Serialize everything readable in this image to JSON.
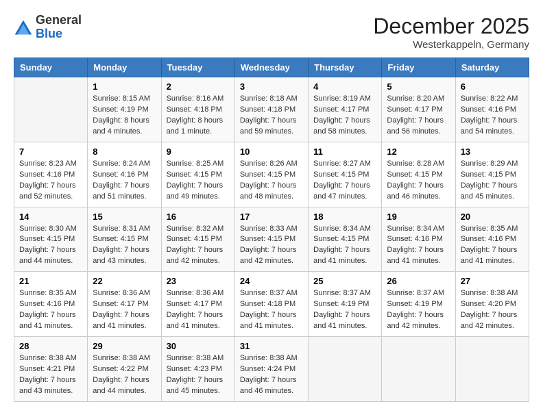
{
  "header": {
    "logo_general": "General",
    "logo_blue": "Blue",
    "month_title": "December 2025",
    "location": "Westerkappeln, Germany"
  },
  "days_of_week": [
    "Sunday",
    "Monday",
    "Tuesday",
    "Wednesday",
    "Thursday",
    "Friday",
    "Saturday"
  ],
  "weeks": [
    [
      {
        "day": "",
        "sunrise": "",
        "sunset": "",
        "daylight": ""
      },
      {
        "day": "1",
        "sunrise": "Sunrise: 8:15 AM",
        "sunset": "Sunset: 4:19 PM",
        "daylight": "Daylight: 8 hours and 4 minutes."
      },
      {
        "day": "2",
        "sunrise": "Sunrise: 8:16 AM",
        "sunset": "Sunset: 4:18 PM",
        "daylight": "Daylight: 8 hours and 1 minute."
      },
      {
        "day": "3",
        "sunrise": "Sunrise: 8:18 AM",
        "sunset": "Sunset: 4:18 PM",
        "daylight": "Daylight: 7 hours and 59 minutes."
      },
      {
        "day": "4",
        "sunrise": "Sunrise: 8:19 AM",
        "sunset": "Sunset: 4:17 PM",
        "daylight": "Daylight: 7 hours and 58 minutes."
      },
      {
        "day": "5",
        "sunrise": "Sunrise: 8:20 AM",
        "sunset": "Sunset: 4:17 PM",
        "daylight": "Daylight: 7 hours and 56 minutes."
      },
      {
        "day": "6",
        "sunrise": "Sunrise: 8:22 AM",
        "sunset": "Sunset: 4:16 PM",
        "daylight": "Daylight: 7 hours and 54 minutes."
      }
    ],
    [
      {
        "day": "7",
        "sunrise": "Sunrise: 8:23 AM",
        "sunset": "Sunset: 4:16 PM",
        "daylight": "Daylight: 7 hours and 52 minutes."
      },
      {
        "day": "8",
        "sunrise": "Sunrise: 8:24 AM",
        "sunset": "Sunset: 4:16 PM",
        "daylight": "Daylight: 7 hours and 51 minutes."
      },
      {
        "day": "9",
        "sunrise": "Sunrise: 8:25 AM",
        "sunset": "Sunset: 4:15 PM",
        "daylight": "Daylight: 7 hours and 49 minutes."
      },
      {
        "day": "10",
        "sunrise": "Sunrise: 8:26 AM",
        "sunset": "Sunset: 4:15 PM",
        "daylight": "Daylight: 7 hours and 48 minutes."
      },
      {
        "day": "11",
        "sunrise": "Sunrise: 8:27 AM",
        "sunset": "Sunset: 4:15 PM",
        "daylight": "Daylight: 7 hours and 47 minutes."
      },
      {
        "day": "12",
        "sunrise": "Sunrise: 8:28 AM",
        "sunset": "Sunset: 4:15 PM",
        "daylight": "Daylight: 7 hours and 46 minutes."
      },
      {
        "day": "13",
        "sunrise": "Sunrise: 8:29 AM",
        "sunset": "Sunset: 4:15 PM",
        "daylight": "Daylight: 7 hours and 45 minutes."
      }
    ],
    [
      {
        "day": "14",
        "sunrise": "Sunrise: 8:30 AM",
        "sunset": "Sunset: 4:15 PM",
        "daylight": "Daylight: 7 hours and 44 minutes."
      },
      {
        "day": "15",
        "sunrise": "Sunrise: 8:31 AM",
        "sunset": "Sunset: 4:15 PM",
        "daylight": "Daylight: 7 hours and 43 minutes."
      },
      {
        "day": "16",
        "sunrise": "Sunrise: 8:32 AM",
        "sunset": "Sunset: 4:15 PM",
        "daylight": "Daylight: 7 hours and 42 minutes."
      },
      {
        "day": "17",
        "sunrise": "Sunrise: 8:33 AM",
        "sunset": "Sunset: 4:15 PM",
        "daylight": "Daylight: 7 hours and 42 minutes."
      },
      {
        "day": "18",
        "sunrise": "Sunrise: 8:34 AM",
        "sunset": "Sunset: 4:15 PM",
        "daylight": "Daylight: 7 hours and 41 minutes."
      },
      {
        "day": "19",
        "sunrise": "Sunrise: 8:34 AM",
        "sunset": "Sunset: 4:16 PM",
        "daylight": "Daylight: 7 hours and 41 minutes."
      },
      {
        "day": "20",
        "sunrise": "Sunrise: 8:35 AM",
        "sunset": "Sunset: 4:16 PM",
        "daylight": "Daylight: 7 hours and 41 minutes."
      }
    ],
    [
      {
        "day": "21",
        "sunrise": "Sunrise: 8:35 AM",
        "sunset": "Sunset: 4:16 PM",
        "daylight": "Daylight: 7 hours and 41 minutes."
      },
      {
        "day": "22",
        "sunrise": "Sunrise: 8:36 AM",
        "sunset": "Sunset: 4:17 PM",
        "daylight": "Daylight: 7 hours and 41 minutes."
      },
      {
        "day": "23",
        "sunrise": "Sunrise: 8:36 AM",
        "sunset": "Sunset: 4:17 PM",
        "daylight": "Daylight: 7 hours and 41 minutes."
      },
      {
        "day": "24",
        "sunrise": "Sunrise: 8:37 AM",
        "sunset": "Sunset: 4:18 PM",
        "daylight": "Daylight: 7 hours and 41 minutes."
      },
      {
        "day": "25",
        "sunrise": "Sunrise: 8:37 AM",
        "sunset": "Sunset: 4:19 PM",
        "daylight": "Daylight: 7 hours and 41 minutes."
      },
      {
        "day": "26",
        "sunrise": "Sunrise: 8:37 AM",
        "sunset": "Sunset: 4:19 PM",
        "daylight": "Daylight: 7 hours and 42 minutes."
      },
      {
        "day": "27",
        "sunrise": "Sunrise: 8:38 AM",
        "sunset": "Sunset: 4:20 PM",
        "daylight": "Daylight: 7 hours and 42 minutes."
      }
    ],
    [
      {
        "day": "28",
        "sunrise": "Sunrise: 8:38 AM",
        "sunset": "Sunset: 4:21 PM",
        "daylight": "Daylight: 7 hours and 43 minutes."
      },
      {
        "day": "29",
        "sunrise": "Sunrise: 8:38 AM",
        "sunset": "Sunset: 4:22 PM",
        "daylight": "Daylight: 7 hours and 44 minutes."
      },
      {
        "day": "30",
        "sunrise": "Sunrise: 8:38 AM",
        "sunset": "Sunset: 4:23 PM",
        "daylight": "Daylight: 7 hours and 45 minutes."
      },
      {
        "day": "31",
        "sunrise": "Sunrise: 8:38 AM",
        "sunset": "Sunset: 4:24 PM",
        "daylight": "Daylight: 7 hours and 46 minutes."
      },
      {
        "day": "",
        "sunrise": "",
        "sunset": "",
        "daylight": ""
      },
      {
        "day": "",
        "sunrise": "",
        "sunset": "",
        "daylight": ""
      },
      {
        "day": "",
        "sunrise": "",
        "sunset": "",
        "daylight": ""
      }
    ]
  ]
}
